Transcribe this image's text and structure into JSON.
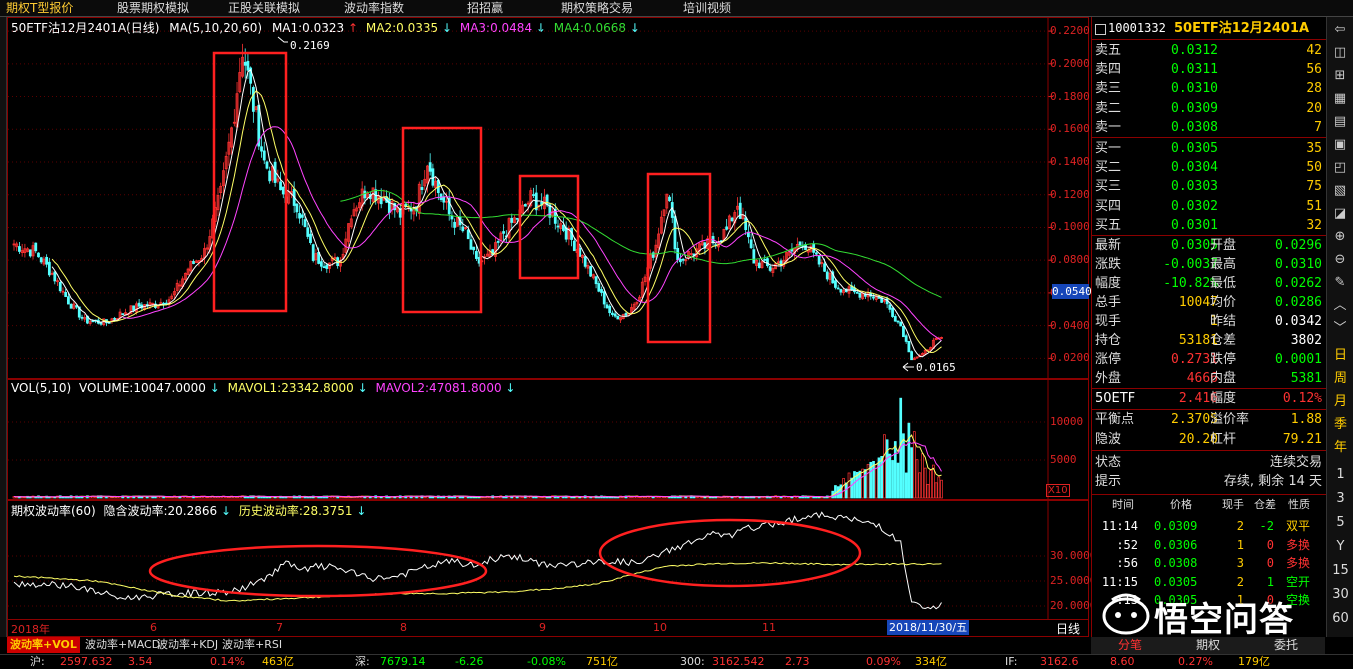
{
  "menu": [
    "期权T型报价",
    "股票期权模拟",
    "正股关联模拟",
    "波动率指数",
    "招招赢",
    "期权策略交易",
    "培训视频"
  ],
  "kline": {
    "legend": {
      "name": "50ETF沽12月2401A(日线)",
      "ma_params": "MA(5,10,20,60)",
      "ma1": "MA1:0.0323",
      "ma2": "MA2:0.0335",
      "ma3": "MA3:0.0484",
      "ma4": "MA4:0.0668"
    },
    "y_ticks": [
      "0.2200",
      "0.2000",
      "0.1800",
      "0.1600",
      "0.1400",
      "0.1200",
      "0.1000",
      "0.0800",
      "0.0600",
      "0.0400",
      "0.0200"
    ],
    "y_range": [
      0.008,
      0.228
    ],
    "current_price_tag": "0.0540",
    "high_annotation": "0.2169",
    "low_annotation": "0.0165",
    "colors": {
      "up": "#ff3232",
      "down": "#54ffff",
      "ma1": "#ffffff",
      "ma2": "#ffff66",
      "ma3": "#ff44ff",
      "ma4": "#33dd33"
    }
  },
  "volume": {
    "legend": {
      "params": "VOL(5,10)",
      "volume": "VOLUME:10047.0000",
      "mavol1": "MAVOL1:23342.8000",
      "mavol2": "MAVOL2:47081.8000"
    },
    "y_ticks": [
      "10000",
      "5000"
    ],
    "unit": "X10"
  },
  "volatility": {
    "legend": {
      "title": "期权波动率(60)",
      "implied": "隐含波动率:20.2866",
      "historical": "历史波动率:28.3751"
    },
    "y_ticks": [
      "30.0000",
      "25.0000",
      "20.0000"
    ]
  },
  "x_axis": {
    "labels": [
      "2018年",
      "6",
      "7",
      "8",
      "9",
      "10",
      "11"
    ],
    "cursor_date": "2018/11/30/五",
    "period": "日线"
  },
  "tabs": [
    "波动率+VOL",
    "波动率+MACD",
    "波动率+KDJ",
    "波动率+RSI"
  ],
  "quote": {
    "code": "10001332",
    "name": "50ETF沽12月2401A",
    "asks": [
      {
        "label": "卖五",
        "price": "0.0312",
        "vol": "42"
      },
      {
        "label": "卖四",
        "price": "0.0311",
        "vol": "56"
      },
      {
        "label": "卖三",
        "price": "0.0310",
        "vol": "28"
      },
      {
        "label": "卖二",
        "price": "0.0309",
        "vol": "20"
      },
      {
        "label": "卖一",
        "price": "0.0308",
        "vol": "7"
      }
    ],
    "bids": [
      {
        "label": "买一",
        "price": "0.0305",
        "vol": "35"
      },
      {
        "label": "买二",
        "price": "0.0304",
        "vol": "50"
      },
      {
        "label": "买三",
        "price": "0.0303",
        "vol": "75"
      },
      {
        "label": "买四",
        "price": "0.0302",
        "vol": "51"
      },
      {
        "label": "买五",
        "price": "0.0301",
        "vol": "32"
      }
    ],
    "stats": [
      {
        "l1": "最新",
        "v1": "0.0305",
        "l2": "开盘",
        "v2": "0.0296"
      },
      {
        "l1": "涨跌",
        "v1": "-0.0037",
        "l2": "最高",
        "v2": "0.0310"
      },
      {
        "l1": "幅度",
        "v1": "-10.82%",
        "l2": "最低",
        "v2": "0.0262"
      },
      {
        "l1": "总手",
        "v1": "10047",
        "l2": "均价",
        "v2": "0.0286"
      },
      {
        "l1": "现手",
        "v1": "1",
        "l2": "昨结",
        "v2": "0.0342"
      },
      {
        "l1": "持仓",
        "v1": "53181",
        "l2": "仓差",
        "v2": "3802"
      },
      {
        "l1": "涨停",
        "v1": "0.2731",
        "l2": "跌停",
        "v2": "0.0001"
      },
      {
        "l1": "外盘",
        "v1": "4666",
        "l2": "内盘",
        "v2": "5381"
      }
    ],
    "underlying": {
      "name": "50ETF",
      "price": "2.416",
      "range_label": "幅度",
      "range": "0.12%"
    },
    "greeks": [
      {
        "l1": "平衡点",
        "v1": "2.3705",
        "l2": "溢价率",
        "v2": "1.88"
      },
      {
        "l1": "隐波",
        "v1": "20.20",
        "l2": "杠杆",
        "v2": "79.21"
      }
    ],
    "state": {
      "label": "状态",
      "value": "连续交易"
    },
    "hint": {
      "label": "提示",
      "value": "存续, 剩余 14 天"
    },
    "trades_header": [
      "时间",
      "价格",
      "现手",
      "仓差",
      "性质"
    ],
    "trades": [
      {
        "time": "11:14",
        "price": "0.0309",
        "qty": "2",
        "oi": "-2",
        "nature": "双平"
      },
      {
        "time": ":52",
        "price": "0.0306",
        "qty": "1",
        "oi": "0",
        "nature": "多换"
      },
      {
        "time": ":56",
        "price": "0.0308",
        "qty": "3",
        "oi": "0",
        "nature": "多换"
      },
      {
        "time": "11:15",
        "price": "0.0305",
        "qty": "2",
        "oi": "1",
        "nature": "空开"
      },
      {
        "time": ":13",
        "price": "0.0305",
        "qty": "1",
        "oi": "0",
        "nature": "空换"
      }
    ],
    "bottom_tabs": [
      "分笔",
      "期权",
      "委托"
    ]
  },
  "toolbar": {
    "period_chars": [
      "日",
      "周",
      "月",
      "季",
      "年"
    ],
    "minute_nums": [
      "1",
      "3",
      "5",
      "Y",
      "15",
      "30",
      "60"
    ]
  },
  "statusbar": {
    "sh": {
      "label": "沪:",
      "value": "2597.632",
      "change": "3.54",
      "pct": "0.14%",
      "amount": "463亿"
    },
    "sz": {
      "label": "深:",
      "value": "7679.14",
      "change": "-6.26",
      "pct": "-0.08%",
      "amount": "751亿"
    },
    "s300": {
      "label": "300:",
      "value": "3162.542",
      "change": "2.73",
      "pct": "0.09%",
      "amount": "334亿"
    },
    "if": {
      "label": "IF:",
      "value": "3162.6",
      "change": "8.60",
      "pct": "0.27%",
      "amount": "179亿"
    }
  },
  "watermark": "悟空问答"
}
